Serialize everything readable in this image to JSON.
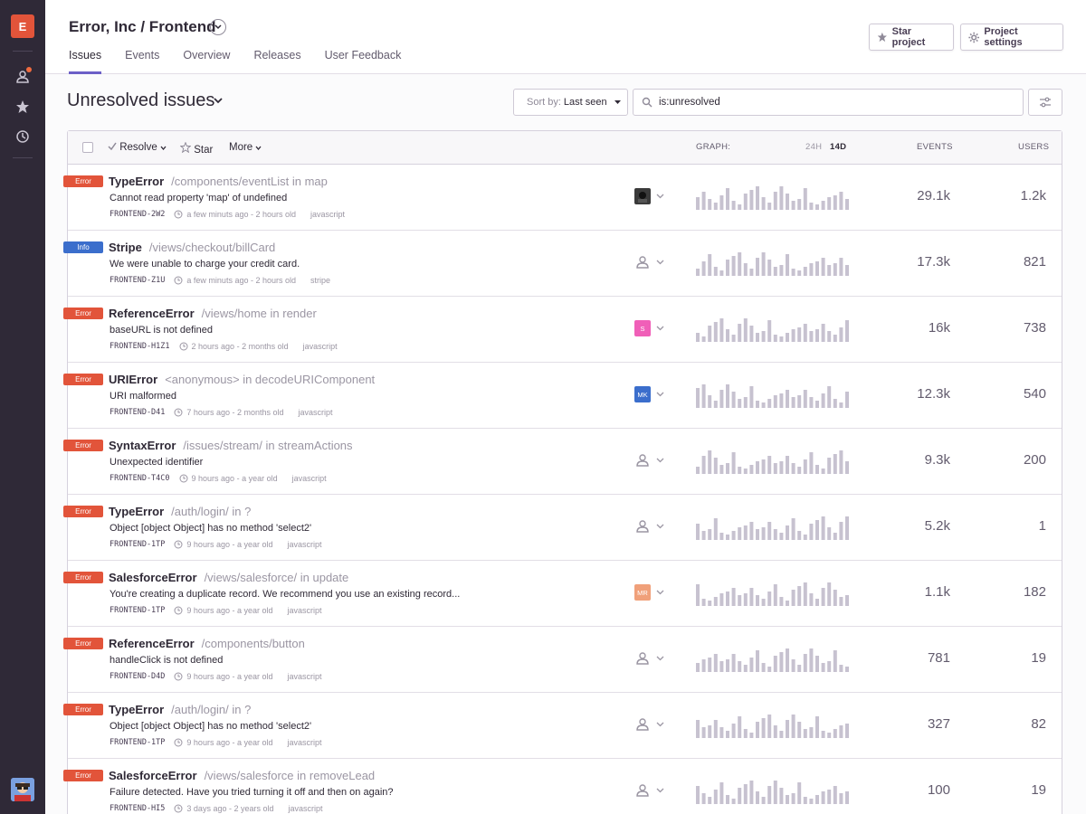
{
  "sidebar": {
    "org_initial": "E",
    "icons": [
      "user-icon",
      "star-icon",
      "activity-icon"
    ]
  },
  "header": {
    "title": "Error, Inc / Frontend",
    "tabs": [
      {
        "label": "Issues",
        "active": true
      },
      {
        "label": "Events",
        "active": false
      },
      {
        "label": "Overview",
        "active": false
      },
      {
        "label": "Releases",
        "active": false
      },
      {
        "label": "User Feedback",
        "active": false
      }
    ],
    "star_button": "Star project",
    "settings_button": "Project settings"
  },
  "page": {
    "title": "Unresolved issues",
    "sort_prefix": "Sort by:",
    "sort_value": "Last seen",
    "search_query": "is:unresolved"
  },
  "table": {
    "toolbar": {
      "resolve": "Resolve",
      "star": "Star",
      "more": "More"
    },
    "columns": {
      "graph": "GRAPH:",
      "range_24h": "24H",
      "range_14d": "14D",
      "events": "EVENTS",
      "users": "USERS"
    },
    "rows": [
      {
        "level": "Error",
        "type": "TypeError",
        "path": "/components/eventList in map",
        "message": "Cannot read property 'map' of undefined",
        "short_id": "FRONTEND-2W2",
        "times": "a few minuts ago - 2 hours old",
        "platform": "javascript",
        "events": "29.1k",
        "users": "1.2k",
        "assignee": {
          "kind": "photo",
          "initials": "",
          "color": "#3a3a3a"
        }
      },
      {
        "level": "Info",
        "type": "Stripe",
        "path": "/views/checkout/billCard",
        "message": "We were unable to charge your credit card.",
        "short_id": "FRONTEND-Z1U",
        "times": "a few minuts ago - 2 hours old",
        "platform": "stripe",
        "events": "17.3k",
        "users": "821",
        "assignee": {
          "kind": "none",
          "initials": "",
          "color": ""
        }
      },
      {
        "level": "Error",
        "type": "ReferenceError",
        "path": "/views/home in render",
        "message": "baseURL is not defined",
        "short_id": "FRONTEND-H1Z1",
        "times": "2 hours ago - 2 months old",
        "platform": "javascript",
        "events": "16k",
        "users": "738",
        "assignee": {
          "kind": "initials",
          "initials": "S",
          "color": "#f05fb8"
        }
      },
      {
        "level": "Error",
        "type": "URIError",
        "path": "<anonymous> in decodeURIComponent",
        "message": "URI malformed",
        "short_id": "FRONTEND-D41",
        "times": "7 hours ago - 2 months old",
        "platform": "javascript",
        "events": "12.3k",
        "users": "540",
        "assignee": {
          "kind": "initials",
          "initials": "MK",
          "color": "#3b6ecc"
        }
      },
      {
        "level": "Error",
        "type": "SyntaxError",
        "path": "/issues/stream/ in streamActions",
        "message": "Unexpected identifier",
        "short_id": "FRONTEND-T4C0",
        "times": "9 hours ago - a year old",
        "platform": "javascript",
        "events": "9.3k",
        "users": "200",
        "assignee": {
          "kind": "none",
          "initials": "",
          "color": ""
        }
      },
      {
        "level": "Error",
        "type": "TypeError",
        "path": "/auth/login/ in ?",
        "message": "Object [object Object] has no method 'select2'",
        "short_id": "FRONTEND-1TP",
        "times": "9 hours ago - a year old",
        "platform": "javascript",
        "events": "5.2k",
        "users": "1",
        "assignee": {
          "kind": "none",
          "initials": "",
          "color": ""
        }
      },
      {
        "level": "Error",
        "type": "SalesforceError",
        "path": "/views/salesforce/ in update",
        "message": "You're creating a duplicate record. We recommend you use an existing record...",
        "short_id": "FRONTEND-1TP",
        "times": "9 hours ago - a year old",
        "platform": "javascript",
        "events": "1.1k",
        "users": "182",
        "assignee": {
          "kind": "initials",
          "initials": "MR",
          "color": "#f0a07a"
        }
      },
      {
        "level": "Error",
        "type": "ReferenceError",
        "path": "/components/button",
        "message": "handleClick is not defined",
        "short_id": "FRONTEND-D4D",
        "times": "9 hours ago - a year old",
        "platform": "javascript",
        "events": "781",
        "users": "19",
        "assignee": {
          "kind": "none",
          "initials": "",
          "color": ""
        }
      },
      {
        "level": "Error",
        "type": "TypeError",
        "path": "/auth/login/ in ?",
        "message": "Object [object Object] has no method 'select2'",
        "short_id": "FRONTEND-1TP",
        "times": "9 hours ago - a year old",
        "platform": "javascript",
        "events": "327",
        "users": "82",
        "assignee": {
          "kind": "none",
          "initials": "",
          "color": ""
        }
      },
      {
        "level": "Error",
        "type": "SalesforceError",
        "path": "/views/salesforce in removeLead",
        "message": "Failure detected. Have you tried turning it off and then on again?",
        "short_id": "FRONTEND-HI5",
        "times": "3 days ago - 2 years old",
        "platform": "javascript",
        "events": "100",
        "users": "19",
        "assignee": {
          "kind": "none",
          "initials": "",
          "color": ""
        }
      }
    ]
  },
  "colors": {
    "sidebar": "#2f2937",
    "accent": "#6c5fc7",
    "error": "#e2543a",
    "info": "#3b6ecc",
    "spark": "#c7c2d0"
  }
}
